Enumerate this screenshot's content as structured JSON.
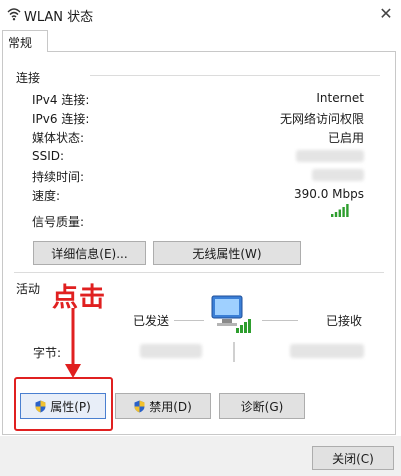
{
  "window": {
    "title": "WLAN 状态",
    "close_glyph": "✕"
  },
  "tabs": [
    {
      "label": "常规"
    }
  ],
  "connection": {
    "heading": "连接",
    "rows": [
      {
        "label": "IPv4 连接:",
        "value": "Internet"
      },
      {
        "label": "IPv6 连接:",
        "value": "无网络访问权限"
      },
      {
        "label": "媒体状态:",
        "value": "已启用"
      },
      {
        "label": "SSID:",
        "value": ""
      },
      {
        "label": "持续时间:",
        "value": ""
      },
      {
        "label": "速度:",
        "value": "390.0 Mbps"
      }
    ],
    "signal_label": "信号质量:",
    "signal_bars": 5,
    "details_button": "详细信息(E)...",
    "wireless_props_button": "无线属性(W)"
  },
  "activity": {
    "heading": "活动",
    "sent_label": "已发送",
    "received_label": "已接收",
    "bytes_label": "字节:"
  },
  "annotation": {
    "text": "点击",
    "color": "#e02020"
  },
  "buttons": {
    "properties": "属性(P)",
    "disable": "禁用(D)",
    "diagnose": "诊断(G)",
    "close": "关闭(C)"
  },
  "icons": {
    "title": "wifi-icon",
    "network": "network-computers-icon",
    "shield": "uac-shield-icon"
  },
  "colors": {
    "signal_green": "#2e9e2e",
    "annotation_red": "#e02020",
    "focus_border": "#4a7fd0"
  }
}
